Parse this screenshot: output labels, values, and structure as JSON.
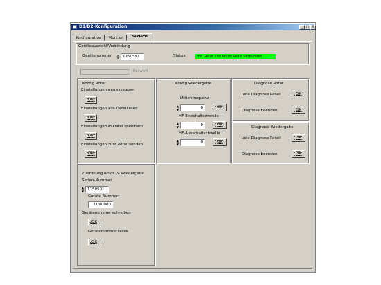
{
  "window": {
    "title": "D1/D2-Konfiguration",
    "minimize": "_",
    "maximize": "□",
    "close": "X"
  },
  "tabs": [
    {
      "label": "Konfiguration",
      "active": false
    },
    {
      "label": "Monitor",
      "active": false
    },
    {
      "label": "Service",
      "active": true
    }
  ],
  "device_selection": {
    "group_title": "Geräteauswahl/Verbindung",
    "device_number_label": "Gerätenummer",
    "device_number_value": "1150501",
    "status_label": "Status",
    "status_text": "mit Gerät und Rotor/Audio verbunden",
    "status_color": "#00ff00",
    "password_placeholder": "Paswort"
  },
  "konfig_rotor": {
    "title": "Konfig Rotor",
    "items": [
      {
        "label": "Einstellungen neu erzeugen",
        "button": "OK"
      },
      {
        "label": "Einstellungen aus Datei lesen",
        "button": "OK"
      },
      {
        "label": "Einstellungen in Datei speichern",
        "button": "OK"
      },
      {
        "label": "Einstellungen zum Rotor senden",
        "button": "OK"
      }
    ]
  },
  "konfig_wiedergabe": {
    "title": "Konfig Wiedergabe",
    "fields": [
      {
        "label": "Mittenfrequenz",
        "value": "0",
        "button": "OK"
      },
      {
        "label": "HF-Einschaltschwelle",
        "value": "0",
        "button": "OK"
      },
      {
        "label": "HF-Ausschaltschwelle",
        "value": "0",
        "button": "OK"
      }
    ]
  },
  "diagnose_rotor": {
    "title": "Diagnose Rotor",
    "load_label": "lade Diagnose Panel",
    "end_label": "Diagnose beenden",
    "button": "OK"
  },
  "diagnose_wiedergabe": {
    "title": "Diagnose Wiedergabe",
    "load_label": "lade Diagnose Panel",
    "end_label": "Diagnose beenden",
    "button": "OK"
  },
  "zuordnung": {
    "title": "Zuordnung Rotor -> Wiedergabe",
    "serial_label": "Serien-Nummer",
    "serial_value": "1150501",
    "device_label": "Geräte-Nummer",
    "device_value": "0000000",
    "write_label": "Gerätenummer schreiben",
    "read_label": "Gerätenummer lesen",
    "button": "OK"
  }
}
